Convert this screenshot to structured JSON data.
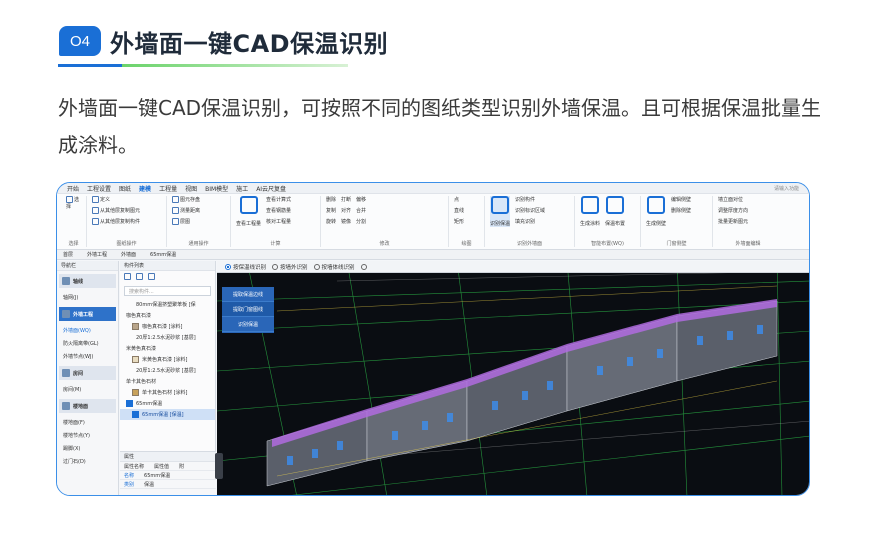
{
  "header": {
    "badge": "O4",
    "title": "外墙面一键CAD保温识别"
  },
  "description": "外墙面一键CAD保温识别，可按照不同的图纸类型识别外墙保温。且可根据保温批量生成涂料。",
  "app": {
    "menu": [
      "开始",
      "工程设置",
      "图纸",
      "建模",
      "工程量",
      "视图",
      "BIM模型",
      "施工",
      "AI云尺复盘"
    ],
    "active_menu": "建模",
    "search_placeholder": "请输入功能",
    "ribbon_groups": [
      {
        "label": "选择",
        "tools": [
          "选择"
        ]
      },
      {
        "label": "图纸操作",
        "tools": [
          "定义",
          "从其他层复制图元",
          "从其他层复制构件"
        ]
      },
      {
        "label": "通用操作",
        "tools": [
          "图元存盘",
          "测量距离",
          "层图"
        ]
      },
      {
        "label": "计算",
        "tools": [
          "查看工程量",
          "查看计算式",
          "查看钢筋量",
          "核对工程量"
        ]
      },
      {
        "label": "修改",
        "tools": [
          "偏移",
          "合并",
          "分割",
          "打断",
          "对齐",
          "镜像",
          "删除",
          "复制",
          "旋转"
        ]
      },
      {
        "label": "绘图",
        "tools": [
          "点",
          "直线",
          "矩形"
        ]
      },
      {
        "label": "识别外墙面",
        "tools": [
          "识别保温",
          "识别构件",
          "识别标识区域",
          "填充识别"
        ]
      },
      {
        "label": "智能布置(WQ)",
        "tools": [
          "生成涂料",
          "保温布置"
        ]
      },
      {
        "label": "门窗侧壁",
        "tools": [
          "生成侧壁",
          "编辑侧壁",
          "删除侧壁"
        ]
      },
      {
        "label": "外墙面编辑",
        "tools": [
          "调整厚度方向",
          "批量更新图元",
          "墙立面对位"
        ]
      }
    ],
    "path": [
      "首层",
      "外墙工程",
      "外墙面",
      "65mm保温"
    ],
    "left_panel": {
      "title": "导航栏",
      "categories": [
        {
          "name": "轴线",
          "items": [
            "轴网(J)"
          ]
        },
        {
          "name": "外墙工程",
          "items": [
            "外墙面(WQ)",
            "防火隔离带(GL)",
            "外墙节点(WJ)"
          ]
        },
        {
          "name": "房间",
          "items": [
            "房间(M)"
          ]
        },
        {
          "name": "楼地面",
          "items": [
            "楼地面(F)",
            "楼地节点(Y)",
            "踢脚(X)",
            "过门石(D)"
          ]
        }
      ]
    },
    "component_panel": {
      "title": "构件列表",
      "search_placeholder": "搜索构件...",
      "items": [
        {
          "text": "80mm保温挤塑聚苯板 [保",
          "level": 1
        },
        {
          "text": "咖色真石漆",
          "level": 0
        },
        {
          "text": "咖色真石漆 [涂料]",
          "level": 1
        },
        {
          "text": "20厚1:2.5水泥砂浆 [基层]",
          "level": 1
        },
        {
          "text": "米黄色真石漆",
          "level": 0
        },
        {
          "text": "米黄色真石漆 [涂料]",
          "level": 1
        },
        {
          "text": "20厚1:2.5水泥砂浆 [基层]",
          "level": 1
        },
        {
          "text": "单卡其色石材",
          "level": 0
        },
        {
          "text": "单卡其色石材 [涂料]",
          "level": 1
        },
        {
          "text": "65mm保温",
          "level": 0
        },
        {
          "text": "65mm保温 [保温]",
          "level": 1
        }
      ]
    },
    "properties": {
      "title": "属性",
      "headers": [
        "属性名称",
        "属性值",
        "附"
      ],
      "rows": [
        [
          "名称",
          "65mm保温"
        ],
        [
          "类别",
          "保温"
        ]
      ]
    },
    "options": [
      "按保温线识别",
      "按墙外识别",
      "按墙体线识别"
    ],
    "active_option": "按保温线识别",
    "popup_menu": [
      "提取保温边线",
      "提取门窗图线",
      "识别保温"
    ],
    "popup_active": "提取门窗图线"
  }
}
